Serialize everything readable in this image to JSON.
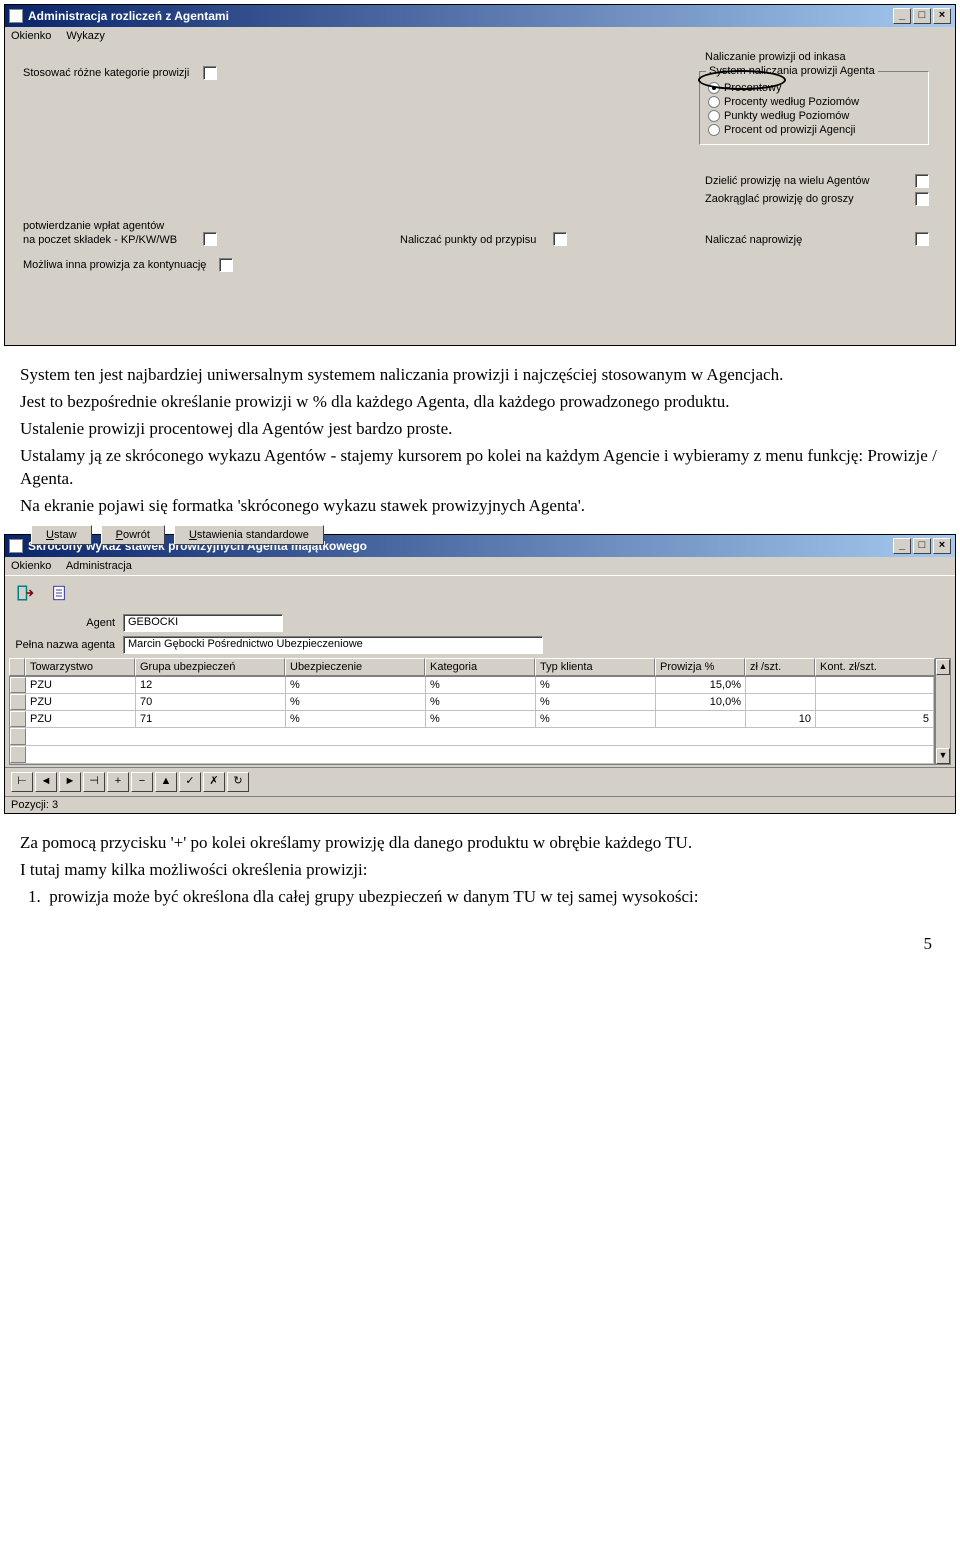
{
  "win1": {
    "title": "Administracja rozliczeń z Agentami",
    "menu": [
      "Okienko",
      "Wykazy"
    ],
    "labels": {
      "stosowac": "Stosować różne kategorie prowizji",
      "potw1": "potwierdzanie wpłat agentów",
      "potw2": "na poczet składek - KP/KW/WB",
      "mozliwa": "Możliwa inna prowizja za kontynuację",
      "naliczac_punkty": "Naliczać punkty od przypisu",
      "dzielic": "Dzielić prowizję na wielu Agentów",
      "zaokraglac": "Zaokrąglać prowizję do groszy",
      "naliczac_nap": "Naliczać naprowizję"
    },
    "group": {
      "legend": "Naliczanie prowizji od inkasa",
      "sublegend": "System naliczania prowizji Agenta",
      "opts": [
        "Procentowy",
        "Procenty według Poziomów",
        "Punkty według Poziomów",
        "Procent od prowizji Agencji"
      ],
      "selected": 0
    },
    "buttons": {
      "ustaw": "Ustaw",
      "powrot": "Powrót",
      "std": "Ustawienia standardowe"
    }
  },
  "text1": {
    "p1": "System ten jest najbardziej uniwersalnym systemem naliczania prowizji i najczęściej stosowanym w Agencjach.",
    "p2": "Jest  to bezpośrednie określanie prowizji w % dla każdego Agenta, dla każdego prowadzonego produktu.",
    "p3": "Ustalenie prowizji procentowej dla Agentów jest bardzo proste.",
    "p4": "Ustalamy ją ze skróconego wykazu Agentów - stajemy kursorem po kolei na każdym Agencie i wybieramy z menu funkcję: Prowizje / Agenta.",
    "p5": "Na ekranie pojawi się formatka 'skróconego wykazu stawek prowizyjnych Agenta'."
  },
  "win2": {
    "title": "Skrócony wykaz stawek prowizyjnych Agenta majątkowego",
    "menu": [
      "Okienko",
      "Administracja"
    ],
    "fields": {
      "agent_label": "Agent",
      "agent_value": "GEBOCKI",
      "pelna_label": "Pełna nazwa agenta",
      "pelna_value": "Marcin Gębocki Pośrednictwo Ubezpieczeniowe"
    },
    "columns": [
      "Towarzystwo",
      "Grupa ubezpieczeń",
      "Ubezpieczenie",
      "Kategoria",
      "Typ klienta",
      "Prowizja %",
      "zł /szt.",
      "Kont. zł/szt."
    ],
    "rows": [
      {
        "tow": "PZU",
        "grupa": "12",
        "ubez": "%",
        "kat": "%",
        "typ": "%",
        "prow": "15,0%",
        "zl": "",
        "kont": ""
      },
      {
        "tow": "PZU",
        "grupa": "70",
        "ubez": "%",
        "kat": "%",
        "typ": "%",
        "prow": "10,0%",
        "zl": "",
        "kont": ""
      },
      {
        "tow": "PZU",
        "grupa": "71",
        "ubez": "%",
        "kat": "%",
        "typ": "%",
        "prow": "",
        "zl": "10",
        "kont": "5"
      }
    ],
    "nav": [
      "⊢",
      "◄",
      "►",
      "⊣",
      "+",
      "−",
      "▲",
      "✓",
      "✗",
      "↻"
    ],
    "status_label": "Pozycji:",
    "status_value": "3"
  },
  "text2": {
    "p1": " Za pomocą przycisku '+' po kolei określamy prowizję dla danego produktu w obrębie każdego TU.",
    "p2": "I tutaj mamy kilka możliwości określenia prowizji:",
    "li1_num": "1.",
    "li1": "prowizja może być określona dla całej grupy ubezpieczeń w danym TU w tej samej wysokości:"
  },
  "pagenum": "5"
}
